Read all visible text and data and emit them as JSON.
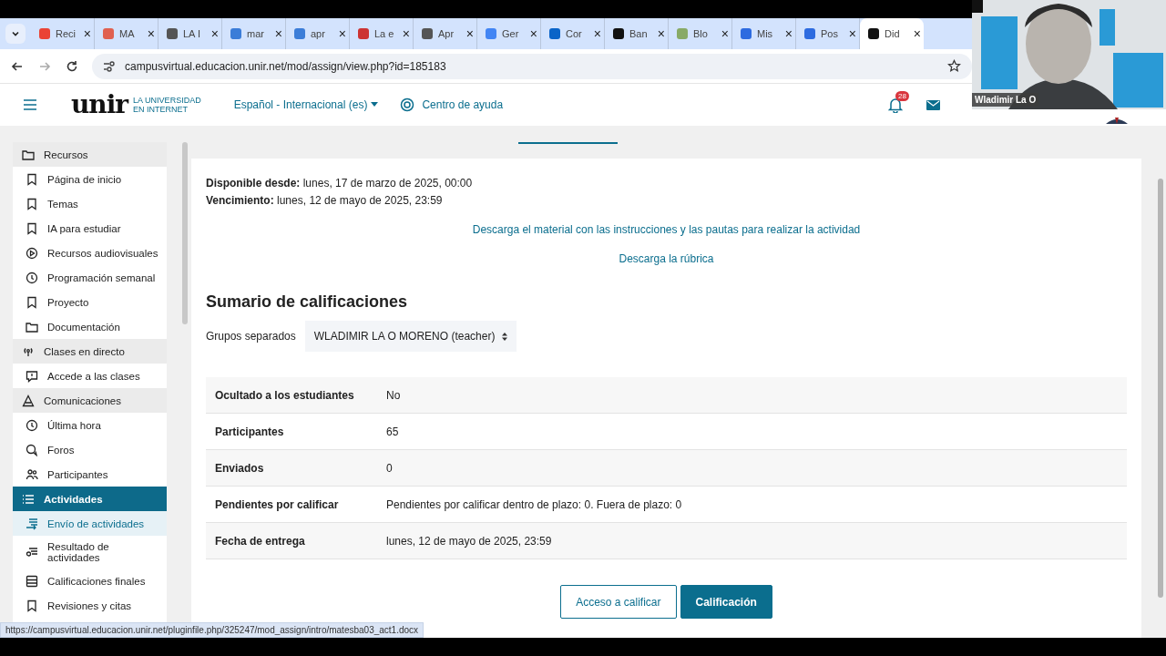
{
  "browser": {
    "tabs": [
      {
        "title": "Reci",
        "selected": false
      },
      {
        "title": "MA",
        "selected": false
      },
      {
        "title": "LA I",
        "selected": false
      },
      {
        "title": "mar",
        "selected": false
      },
      {
        "title": "apr",
        "selected": false
      },
      {
        "title": "La e",
        "selected": false
      },
      {
        "title": "Apr",
        "selected": false
      },
      {
        "title": "Ger",
        "selected": false
      },
      {
        "title": "Cor",
        "selected": false
      },
      {
        "title": "Ban",
        "selected": false
      },
      {
        "title": "Blo",
        "selected": false
      },
      {
        "title": "Mis",
        "selected": false
      },
      {
        "title": "Pos",
        "selected": false
      },
      {
        "title": "Did",
        "selected": true
      }
    ],
    "tab_close": "×",
    "url": "campusvirtual.educacion.unir.net/mod/assign/view.php?id=185183",
    "status_url": "https://campusvirtual.educacion.unir.net/pluginfile.php/325247/mod_assign/intro/matesba03_act1.docx"
  },
  "header": {
    "logo": "unir",
    "logo_tagline": [
      "LA UNIVERSIDAD",
      "EN INTERNET"
    ],
    "language": "Español - Internacional (es)",
    "help": "Centro de ayuda",
    "notifications": "28"
  },
  "sidebar": {
    "items": [
      {
        "label": "Recursos",
        "kind": "section",
        "selected": false
      },
      {
        "label": "Página de inicio",
        "kind": "item",
        "selected": false
      },
      {
        "label": "Temas",
        "kind": "item",
        "selected": false
      },
      {
        "label": "IA para estudiar",
        "kind": "item",
        "selected": false
      },
      {
        "label": "Recursos audiovisuales",
        "kind": "item",
        "selected": false
      },
      {
        "label": "Programación semanal",
        "kind": "item",
        "selected": false
      },
      {
        "label": "Proyecto",
        "kind": "item",
        "selected": false
      },
      {
        "label": "Documentación",
        "kind": "item",
        "selected": false
      },
      {
        "label": "Clases en directo",
        "kind": "section",
        "selected": false
      },
      {
        "label": "Accede a las clases",
        "kind": "item",
        "selected": false
      },
      {
        "label": "Comunicaciones",
        "kind": "section",
        "selected": false
      },
      {
        "label": "Última hora",
        "kind": "item",
        "selected": false
      },
      {
        "label": "Foros",
        "kind": "item",
        "selected": false
      },
      {
        "label": "Participantes",
        "kind": "item",
        "selected": false
      },
      {
        "label": "Actividades",
        "kind": "section",
        "selected": true
      },
      {
        "label": "Envío de actividades",
        "kind": "item",
        "selected": true
      },
      {
        "label": "Resultado de actividades",
        "kind": "item",
        "selected": false
      },
      {
        "label": "Calificaciones finales",
        "kind": "item",
        "selected": false
      },
      {
        "label": "Revisiones y citas",
        "kind": "item",
        "selected": false
      }
    ]
  },
  "content": {
    "dates": [
      {
        "label": "Disponible desde:",
        "value": "lunes, 17 de marzo de 2025, 00:00"
      },
      {
        "label": "Vencimiento:",
        "value": "lunes, 12 de mayo de 2025, 23:59"
      }
    ],
    "links": [
      "Descarga el material con las instrucciones y las pautas para realizar la actividad",
      "Descarga la rúbrica"
    ],
    "summary_title": "Sumario de calificaciones",
    "groups_label": "Grupos separados",
    "groups_value": "WLADIMIR LA O MORENO (teacher)",
    "table": {
      "rows": [
        {
          "label": "Ocultado a los estudiantes",
          "value": "No"
        },
        {
          "label": "Participantes",
          "value": "65"
        },
        {
          "label": "Enviados",
          "value": "0"
        },
        {
          "label": "Pendientes por calificar",
          "value": "Pendientes por calificar dentro de plazo: 0. Fuera de plazo: 0"
        },
        {
          "label": "Fecha de entrega",
          "value": "lunes, 12 de mayo de 2025, 23:59"
        }
      ]
    },
    "buttons": [
      {
        "label": "Acceso a calificar",
        "kind": "secondary"
      },
      {
        "label": "Calificación",
        "kind": "primary"
      }
    ]
  },
  "webcam": {
    "kind": "picture",
    "name": "Wladimir La O"
  }
}
